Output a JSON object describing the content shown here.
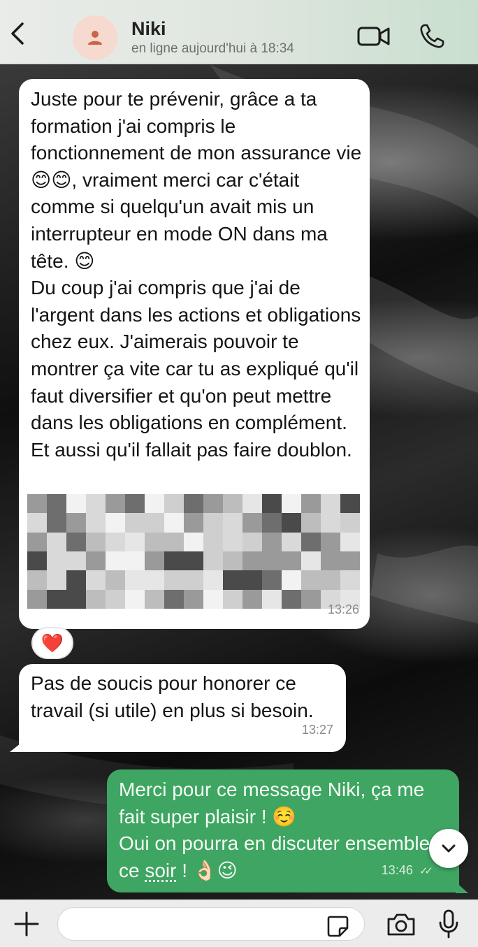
{
  "header": {
    "back_icon": "chevron-left-icon",
    "contact_name": "Niki",
    "status": "en ligne aujourd'hui à 18:34",
    "video_icon": "video-camera-icon",
    "call_icon": "phone-icon",
    "avatar_icon": "person-icon"
  },
  "messages": [
    {
      "direction": "incoming",
      "text": "Juste pour te prévenir, grâce a ta formation j'ai compris le fonctionnement de mon assurance vie 😊😊, vraiment merci car c'était comme si quelqu'un avait mis un interrupteur en mode ON dans ma tête. 😊\nDu coup j'ai compris que j'ai de l'argent dans les actions et obligations chez eux. J'aimerais pouvoir te montrer ça vite car tu as expliqué qu'il faut diversifier et qu'on peut mettre dans les obligations en complément. Et aussi qu'il fallait pas faire doublon.",
      "has_pixelated_block": true,
      "time": "13:26",
      "reaction": "❤️"
    },
    {
      "direction": "incoming",
      "text": "Pas de soucis pour honorer ce travail (si utile) en plus si besoin.",
      "time": "13:27"
    },
    {
      "direction": "outgoing",
      "text_line1": "Merci pour ce message Niki, ça me fait super plaisir ! ☺️\nOui on pourra en discuter ensemble ce ",
      "text_underlined": "soir",
      "text_end": " ! 👌🏻😉",
      "time": "13:46",
      "read_receipt": "✓✓"
    }
  ],
  "scroll_down_icon": "chevron-down-icon",
  "input_bar": {
    "plus_icon": "plus-icon",
    "placeholder": "",
    "sticker_icon": "sticker-icon",
    "camera_icon": "camera-icon",
    "mic_icon": "microphone-icon"
  },
  "colors": {
    "outgoing_bubble": "#3fa562",
    "incoming_bubble": "#ffffff",
    "avatar_bg": "#f6d9cf",
    "avatar_icon": "#c9654a"
  }
}
